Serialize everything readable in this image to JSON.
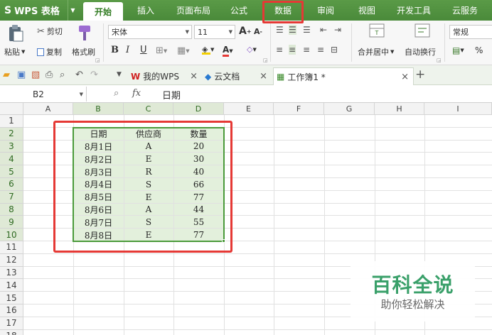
{
  "app": {
    "logo": "S",
    "name": "WPS 表格"
  },
  "menu_tabs": [
    {
      "label": "开始",
      "active": true
    },
    {
      "label": "插入"
    },
    {
      "label": "页面布局"
    },
    {
      "label": "公式"
    },
    {
      "label": "数据",
      "highlighted": true
    },
    {
      "label": "审阅"
    },
    {
      "label": "视图"
    },
    {
      "label": "开发工具"
    },
    {
      "label": "云服务"
    }
  ],
  "ribbon": {
    "paste": "粘贴",
    "cut": "剪切",
    "copy": "复制",
    "format_painter": "格式刷",
    "font_name": "宋体",
    "font_size": "11",
    "bold": "B",
    "italic": "I",
    "underline": "U",
    "merge_center": "合并居中",
    "wrap_text": "自动换行",
    "number_format": "常规",
    "percent": "%"
  },
  "doc_tabs": [
    {
      "label": "我的WPS"
    },
    {
      "label": "云文档"
    },
    {
      "label": "工作簿1 *",
      "active": true
    }
  ],
  "formula_bar": {
    "cell_ref": "B2",
    "fx": "fx",
    "content": "日期"
  },
  "columns": [
    "A",
    "B",
    "C",
    "D",
    "E",
    "F",
    "G",
    "H",
    "I"
  ],
  "rows": [
    "1",
    "2",
    "3",
    "4",
    "5",
    "6",
    "7",
    "8",
    "9",
    "10",
    "11",
    "12",
    "13",
    "14",
    "15",
    "16",
    "17",
    "18"
  ],
  "table": {
    "headers": [
      "日期",
      "供应商",
      "数量"
    ],
    "rows": [
      [
        "8月1日",
        "A",
        "20"
      ],
      [
        "8月2日",
        "E",
        "30"
      ],
      [
        "8月3日",
        "R",
        "40"
      ],
      [
        "8月4日",
        "S",
        "66"
      ],
      [
        "8月5日",
        "E",
        "77"
      ],
      [
        "8月6日",
        "A",
        "44"
      ],
      [
        "8月7日",
        "S",
        "55"
      ],
      [
        "8月8日",
        "E",
        "77"
      ]
    ]
  },
  "watermark": {
    "title": "百科全说",
    "subtitle": "助你轻松解决"
  },
  "colors": {
    "accent": "#4a8a3a",
    "highlight": "#e53935",
    "selection_fill": "#e3f0dc"
  }
}
